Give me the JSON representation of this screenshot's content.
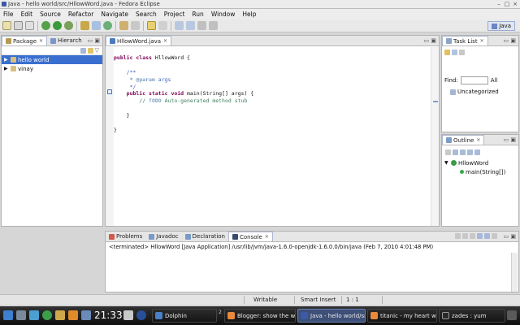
{
  "window": {
    "title": "Java - hello world/src/HllowWord.java - Fedora Eclipse"
  },
  "menu": [
    "File",
    "Edit",
    "Source",
    "Refactor",
    "Navigate",
    "Search",
    "Project",
    "Run",
    "Window",
    "Help"
  ],
  "perspective": "Java",
  "package_explorer": {
    "tabs": [
      "Package",
      "Hierarch"
    ],
    "items": [
      {
        "label": "hello world",
        "selected": true
      },
      {
        "label": "vinay",
        "selected": false
      }
    ]
  },
  "editor": {
    "tab": "HllowWord.java",
    "lines": [
      {
        "t": "public class HllowWord {"
      },
      {
        "t": ""
      },
      {
        "t": "    /**"
      },
      {
        "t": "     * @param args"
      },
      {
        "t": "     */"
      },
      {
        "t": "    public static void main(String[] args) {"
      },
      {
        "t": "        // TODO Auto-generated method stub"
      },
      {
        "t": ""
      },
      {
        "t": "    }"
      },
      {
        "t": ""
      },
      {
        "t": "}"
      }
    ]
  },
  "task_list": {
    "tab": "Task List",
    "find_label": "Find:",
    "all_label": "All",
    "category": "Uncategorized"
  },
  "outline": {
    "tab": "Outline",
    "class": "HllowWord",
    "method": "main(String[])"
  },
  "bottom": {
    "tabs": [
      "Problems",
      "Javadoc",
      "Declaration",
      "Console"
    ],
    "active_tab": "Console",
    "console_text": "<terminated> HllowWord [Java Application] /usr/lib/jvm/java-1.6.0-openjdk-1.6.0.0/bin/java (Feb 7, 2010 4:01:48 PM)"
  },
  "status": {
    "writable": "Writable",
    "insert": "Smart Insert",
    "position": "1 : 1"
  },
  "taskbar": {
    "clock": "21:33",
    "badge": "2",
    "tasks": [
      "Dolphin",
      "Blogger: show the w",
      "Java - hello world/src/",
      "titanic - my heart wil",
      "zades : yum"
    ]
  },
  "colors": {
    "accent": "#3a6fd0",
    "keyword": "#7f0055",
    "comment": "#3f5fbf",
    "line_comment": "#3f7f5f"
  }
}
